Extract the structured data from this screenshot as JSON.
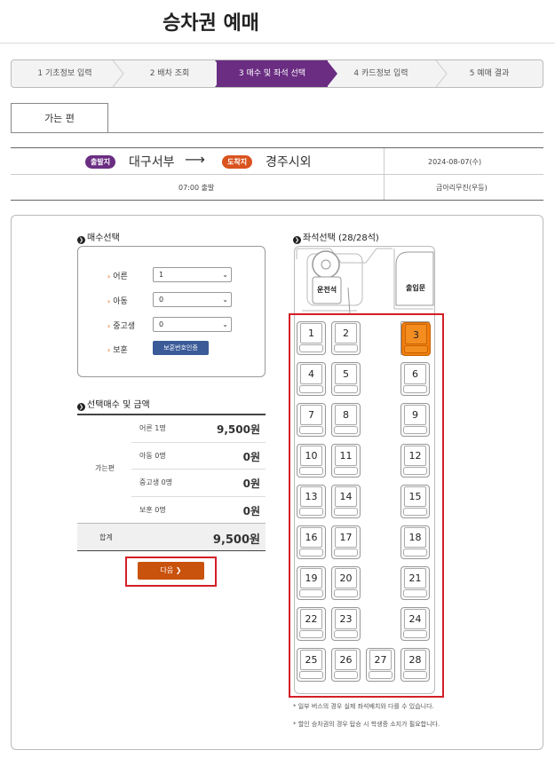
{
  "page": {
    "title": "승차권 예매"
  },
  "steps": [
    {
      "label": "1 기초정보 입력",
      "active": false
    },
    {
      "label": "2 배차 조회",
      "active": false
    },
    {
      "label": "3 매수 및 좌석 선택",
      "active": true
    },
    {
      "label": "4 카드정보 입력",
      "active": false
    },
    {
      "label": "5 예매 결과",
      "active": false
    }
  ],
  "tab": {
    "label": "가는 편"
  },
  "route": {
    "departure_badge": "출발지",
    "departure": "대구서부",
    "arrow": "⟶",
    "arrival_badge": "도착지",
    "arrival": "경주시외",
    "date": "2024-08-07(수)",
    "time": "07:00 출발",
    "company": "금아리무진(우등)"
  },
  "quantity": {
    "title": "매수선택",
    "rows": [
      {
        "label": "어른",
        "value": "1"
      },
      {
        "label": "아동",
        "value": "0"
      },
      {
        "label": "중고생",
        "value": "0"
      }
    ],
    "guardian_label": "보훈",
    "guardian_button": "보훈번호인증"
  },
  "summary": {
    "title": "선택매수 및 금액",
    "group": "가는편",
    "rows": [
      {
        "label": "어른 1명",
        "amount": "9,500원"
      },
      {
        "label": "아동 0명",
        "amount": "0원"
      },
      {
        "label": "중고생 0명",
        "amount": "0원"
      },
      {
        "label": "보훈 0명",
        "amount": "0원"
      }
    ],
    "total_label": "합계",
    "total": "9,500원"
  },
  "next_button": "다음 ❯",
  "seats": {
    "title": "좌석선택 (28/28석)",
    "driver": "운전석",
    "door": "출입문",
    "selected": "3",
    "numbers": [
      "1",
      "2",
      "3",
      "4",
      "5",
      "6",
      "7",
      "8",
      "9",
      "10",
      "11",
      "12",
      "13",
      "14",
      "15",
      "16",
      "17",
      "18",
      "19",
      "20",
      "21",
      "22",
      "23",
      "24",
      "25",
      "26",
      "27",
      "28"
    ]
  },
  "notes": [
    "* 일부 버스의 경우 실제 좌석배치와 다를 수 있습니다.",
    "* 할인 승차권의 경우 탑승 시 학생증 소지가 필요합니다."
  ],
  "colors": {
    "accent": "#6a2d82",
    "departure_badge": "#6a2d82",
    "arrival_badge": "#d9531e",
    "selected_seat": "#f07e10",
    "next": "#c9520d",
    "highlight": "#d31f26"
  }
}
